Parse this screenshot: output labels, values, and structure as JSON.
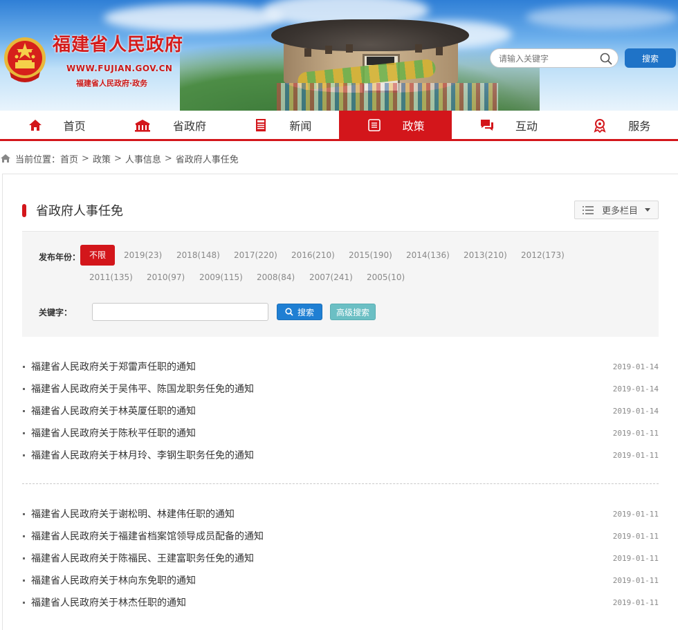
{
  "header": {
    "site_title": "福建省人民政府",
    "site_url": "WWW.FUJIAN.GOV.CN",
    "site_sub": "福建省人民政府·政务",
    "search_placeholder": "请输入关键字",
    "search_button": "搜索",
    "brand_red": "#d3161b",
    "brand_blue": "#1f73c7"
  },
  "nav": [
    {
      "label": "首页",
      "icon": "home-icon",
      "active": false
    },
    {
      "label": "省政府",
      "icon": "building-icon",
      "active": false
    },
    {
      "label": "新闻",
      "icon": "news-icon",
      "active": false
    },
    {
      "label": "政策",
      "icon": "document-icon",
      "active": true
    },
    {
      "label": "互动",
      "icon": "chat-icon",
      "active": false
    },
    {
      "label": "服务",
      "icon": "service-icon",
      "active": false
    }
  ],
  "breadcrumb": {
    "prefix": "当前位置：",
    "items": [
      "首页",
      "政策",
      "人事信息",
      "省政府人事任免"
    ]
  },
  "column": {
    "title": "省政府人事任免",
    "more_label": "更多栏目"
  },
  "filter": {
    "year_label": "发布年份：",
    "years": [
      "不限",
      "2019(23)",
      "2018(148)",
      "2017(220)",
      "2016(210)",
      "2015(190)",
      "2014(136)",
      "2013(210)",
      "2012(173)",
      "2011(135)",
      "2010(97)",
      "2009(115)",
      "2008(84)",
      "2007(241)",
      "2005(10)"
    ],
    "keyword_label": "关键字：",
    "search_button": "搜索",
    "advanced_button": "高级搜索"
  },
  "list_group_1": [
    {
      "title": "福建省人民政府关于郑雷声任职的通知",
      "date": "2019-01-14"
    },
    {
      "title": "福建省人民政府关于吴伟平、陈国龙职务任免的通知",
      "date": "2019-01-14"
    },
    {
      "title": "福建省人民政府关于林英厦任职的通知",
      "date": "2019-01-14"
    },
    {
      "title": "福建省人民政府关于陈秋平任职的通知",
      "date": "2019-01-11"
    },
    {
      "title": "福建省人民政府关于林月玲、李钢生职务任免的通知",
      "date": "2019-01-11"
    }
  ],
  "list_group_2": [
    {
      "title": "福建省人民政府关于谢松明、林建伟任职的通知",
      "date": "2019-01-11"
    },
    {
      "title": "福建省人民政府关于福建省档案馆领导成员配备的通知",
      "date": "2019-01-11"
    },
    {
      "title": "福建省人民政府关于陈福民、王建富职务任免的通知",
      "date": "2019-01-11"
    },
    {
      "title": "福建省人民政府关于林向东免职的通知",
      "date": "2019-01-11"
    },
    {
      "title": "福建省人民政府关于林杰任职的通知",
      "date": "2019-01-11"
    }
  ]
}
